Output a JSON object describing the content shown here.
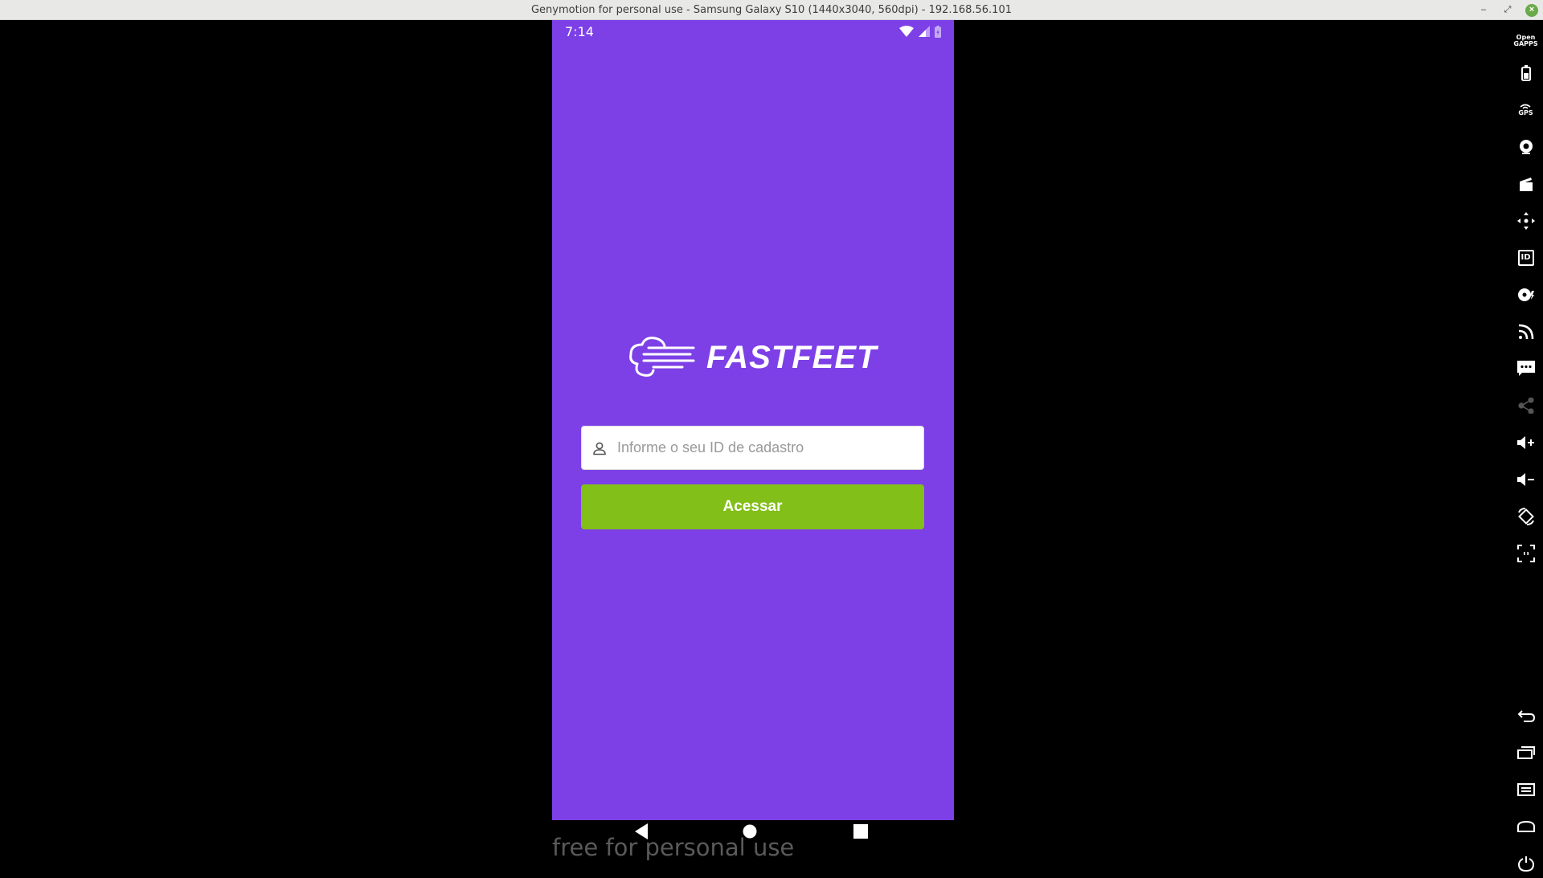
{
  "window": {
    "title": "Genymotion for personal use - Samsung Galaxy S10 (1440x3040, 560dpi) - 192.168.56.101"
  },
  "status_bar": {
    "time": "7:14"
  },
  "app": {
    "logo_text": "FASTFEET",
    "id_input": {
      "value": "",
      "placeholder": "Informe o seu ID de cadastro"
    },
    "login_button": "Acessar",
    "colors": {
      "background": "#7d40e7",
      "button": "#82bf18"
    }
  },
  "watermark": "free for personal use",
  "toolbar": {
    "open_gapps_label": "Open GAPPS",
    "gps_label": "GPS",
    "id_label": "ID",
    "items": [
      "open-gapps-icon",
      "battery-icon",
      "gps-icon",
      "webcam-icon",
      "media-icon",
      "move-icon",
      "device-id-icon",
      "disk-icon",
      "network-icon",
      "sms-icon",
      "share-icon",
      "volume-up-icon",
      "volume-down-icon",
      "rotate-icon",
      "pixel-perfect-icon",
      "back-icon",
      "recent-apps-icon",
      "menu-icon",
      "home-icon",
      "power-icon"
    ]
  }
}
